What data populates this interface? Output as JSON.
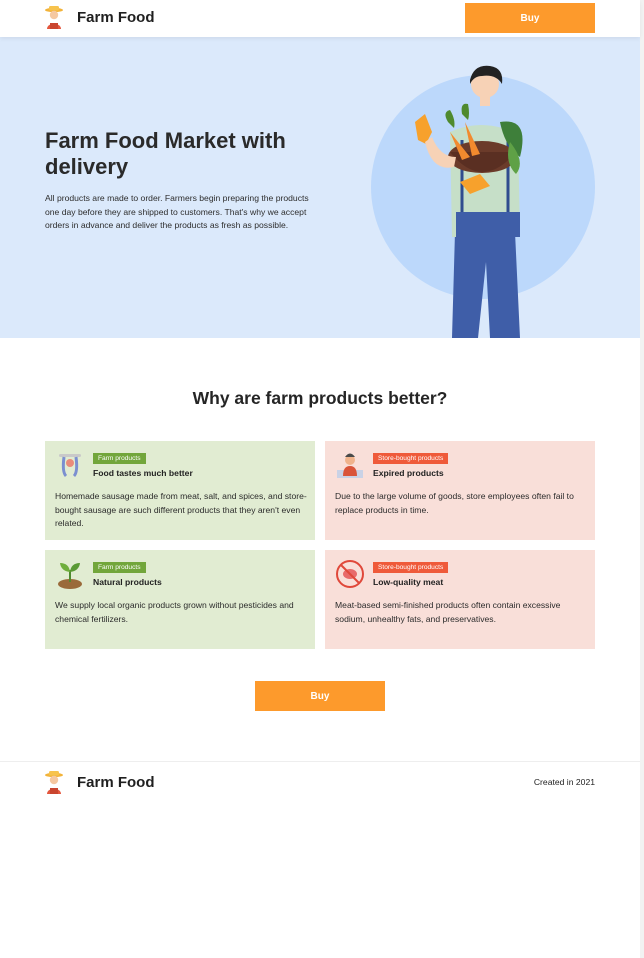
{
  "brand": {
    "name": "Farm Food"
  },
  "header": {
    "buy_label": "Buy"
  },
  "hero": {
    "title": "Farm Food Market with delivery",
    "description": "All products are made to order. Farmers begin preparing the products one day before they are shipped to customers. That's why we accept orders in advance and deliver the products as fresh as possible."
  },
  "benefits": {
    "title": "Why are farm products better?",
    "cards": [
      {
        "tag": "Farm products",
        "title": "Food tastes much better",
        "text": "Homemade sausage made from meat, salt, and spices, and store-bought sausage are such different products that they aren't even related.",
        "icon": "sausage-icon"
      },
      {
        "tag": "Store-bought products",
        "title": "Expired products",
        "text": "Due to the large volume of goods, store employees often fail to replace products in time.",
        "icon": "worker-icon"
      },
      {
        "tag": "Farm products",
        "title": "Natural products",
        "text": "We supply local organic products grown without pesticides and chemical fertilizers.",
        "icon": "sprout-icon"
      },
      {
        "tag": "Store-bought products",
        "title": "Low-quality meat",
        "text": "Meat-based semi-finished products often contain excessive sodium, unhealthy fats, and preservatives.",
        "icon": "no-meat-icon"
      }
    ],
    "buy_label": "Buy"
  },
  "footer": {
    "note": "Created in 2021"
  },
  "colors": {
    "accent": "#fd9a2c",
    "hero_bg": "#dbe9fb",
    "farm_card": "#e1ecd2",
    "store_card": "#f9dfd9",
    "farm_tag": "#72a63b",
    "store_tag": "#ef5a3a"
  }
}
